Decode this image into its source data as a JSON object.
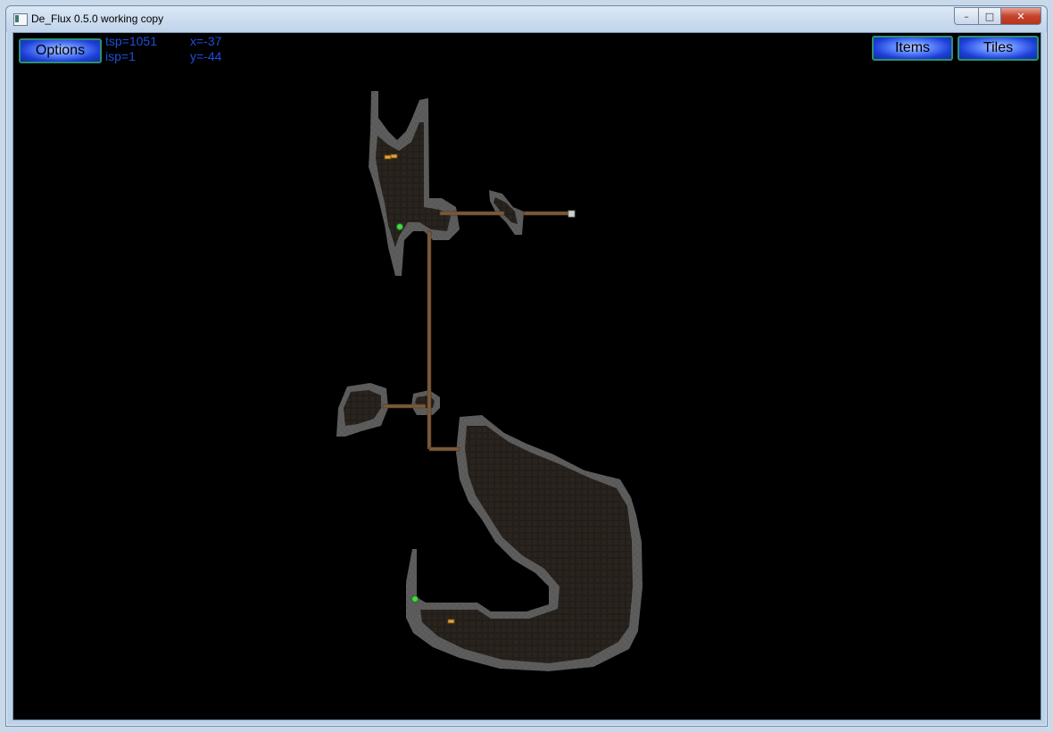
{
  "window": {
    "title": "De_Flux 0.5.0 working copy",
    "controls": {
      "minimize": "–",
      "maximize": "□",
      "close": "✕"
    }
  },
  "hud": {
    "options_label": "Options",
    "tsp": "tsp=1051",
    "isp": "isp=1",
    "x": "x=-37",
    "y": "y=-44",
    "items_label": "Items",
    "tiles_label": "Tiles"
  },
  "colors": {
    "background": "#000000",
    "wall": "#5a5a5a",
    "floor": "#2a241e",
    "path": "#7a5a3a",
    "hud_text": "#1e4fd8"
  },
  "icons": [
    "app-icon",
    "treasure-icon",
    "green-orb-icon",
    "door-icon"
  ]
}
